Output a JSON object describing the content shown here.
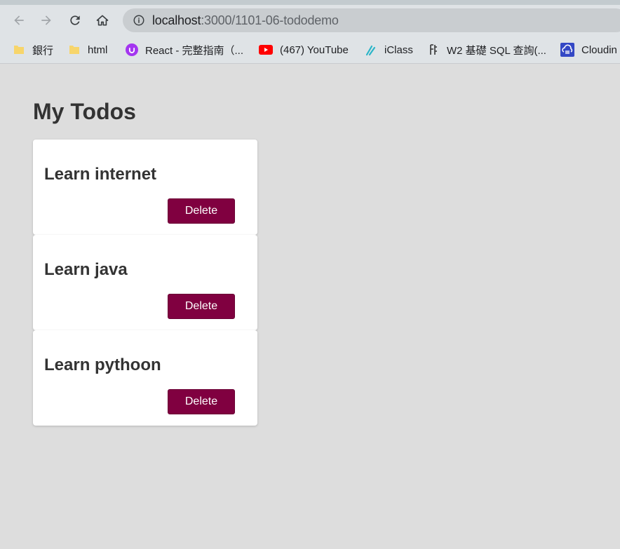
{
  "browser": {
    "url_host": "localhost",
    "url_path": ":3000/1101-06-tododemo",
    "bookmarks": [
      {
        "label": "銀行",
        "icon": "folder-icon"
      },
      {
        "label": "html",
        "icon": "folder-icon"
      },
      {
        "label": "React - 完整指南（...",
        "icon": "udemy-icon"
      },
      {
        "label": "(467) YouTube",
        "icon": "youtube-icon"
      },
      {
        "label": "iClass",
        "icon": "iclass-icon"
      },
      {
        "label": "W2 基礎 SQL 查詢(...",
        "icon": "sql-icon"
      },
      {
        "label": "Cloudin",
        "icon": "cloudinary-icon"
      }
    ]
  },
  "page": {
    "title": "My Todos",
    "todos": [
      {
        "text": "Learn internet",
        "delete_label": "Delete"
      },
      {
        "text": "Learn java",
        "delete_label": "Delete"
      },
      {
        "text": "Learn pythoon",
        "delete_label": "Delete"
      }
    ]
  },
  "colors": {
    "page_background": "#dddddd",
    "card_background": "#ffffff",
    "delete_button": "#800040",
    "text": "#333333"
  }
}
